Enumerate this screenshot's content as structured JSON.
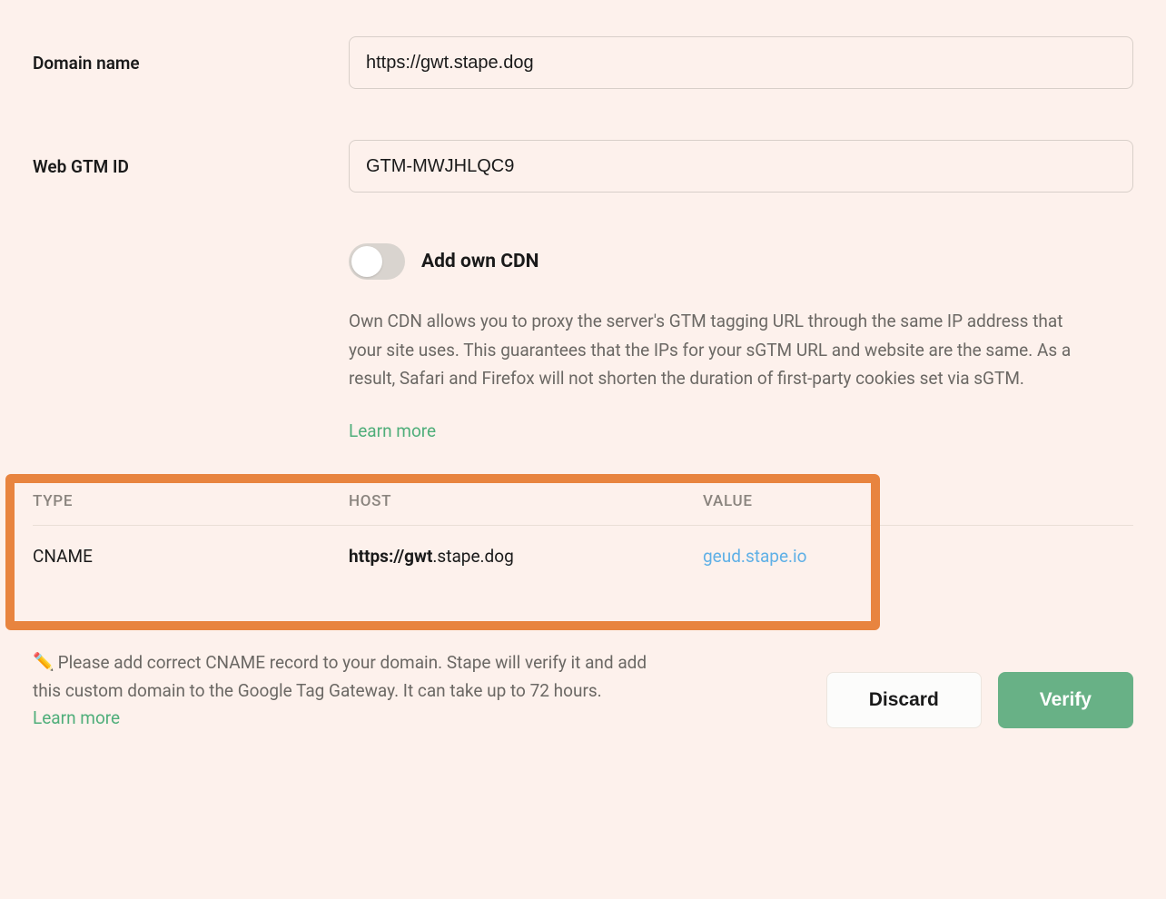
{
  "form": {
    "domain_label": "Domain name",
    "domain_value": "https://gwt.stape.dog",
    "gtm_label": "Web GTM ID",
    "gtm_value": "GTM-MWJHLQC9"
  },
  "cdn": {
    "toggle_label": "Add own CDN",
    "description": "Own CDN allows you to proxy the server's GTM tagging URL through the same IP address that your site uses. This guarantees that the IPs for your sGTM URL and website are the same. As a result, Safari and Firefox will not shorten the duration of first-party cookies set via sGTM.",
    "learn_more": "Learn more"
  },
  "table": {
    "headers": {
      "type": "TYPE",
      "host": "HOST",
      "value": "VALUE"
    },
    "row": {
      "type": "CNAME",
      "host_bold": "https://gwt",
      "host_rest": ".stape.dog",
      "value": "geud.stape.io"
    }
  },
  "footer": {
    "note": "Please add correct CNAME record to your domain. Stape will verify it and add this custom domain to the Google Tag Gateway. It can take up to 72 hours.",
    "learn_more": "Learn more",
    "discard": "Discard",
    "verify": "Verify"
  }
}
